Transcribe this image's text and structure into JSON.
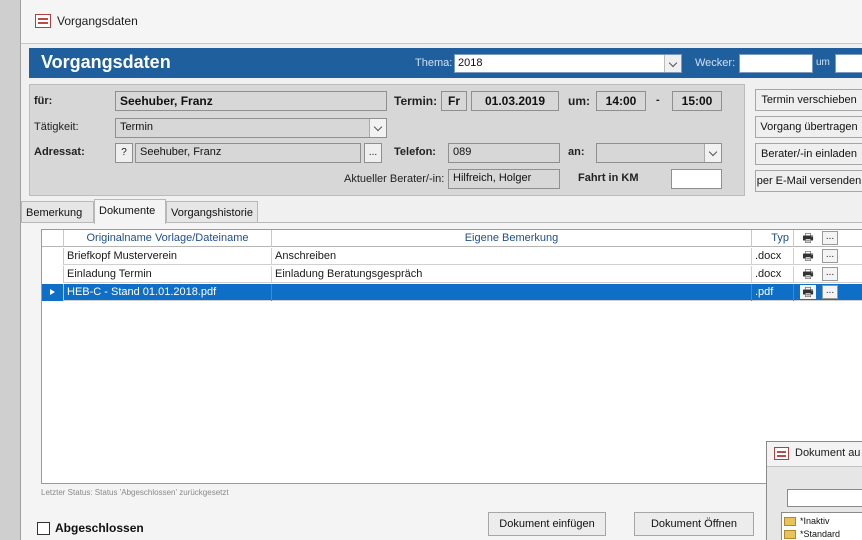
{
  "window": {
    "title": "Vorgangsdaten"
  },
  "header": {
    "title": "Vorgangsdaten",
    "thema_label": "Thema:",
    "thema_value": "2018",
    "wecker_label": "Wecker:",
    "um_label": "um"
  },
  "form": {
    "fuer_label": "für:",
    "fuer_value": "Seehuber, Franz",
    "termin_label": "Termin:",
    "termin_day": "Fr",
    "termin_date": "01.03.2019",
    "um_label": "um:",
    "time_from": "14:00",
    "dash": "-",
    "time_to": "15:00",
    "taetigkeit_label": "Tätigkeit:",
    "taetigkeit_value": "Termin",
    "adressat_label": "Adressat:",
    "adressat_q": "?",
    "adressat_value": "Seehuber, Franz",
    "dots": "...",
    "telefon_label": "Telefon:",
    "telefon_value": "089",
    "an_label": "an:",
    "berater_label": "Aktueller Berater/-in:",
    "berater_value": "Hilfreich, Holger",
    "fahrt_label": "Fahrt in KM"
  },
  "side_buttons": {
    "termin_verschieben": "Termin verschieben",
    "vorgang_uebertragen": "Vorgang übertragen",
    "berater_einladen": "Berater/-in einladen",
    "email_versenden": "per E-Mail versenden"
  },
  "tabs": [
    "Bemerkung",
    "Dokumente",
    "Vorgangshistorie"
  ],
  "grid": {
    "columns": [
      "Originalname Vorlage/Dateiname",
      "Eigene Bemerkung",
      "Typ"
    ],
    "rows": [
      {
        "name": "Briefkopf Musterverein",
        "note": "Anschreiben",
        "typ": ".docx"
      },
      {
        "name": "Einladung Termin",
        "note": "Einladung Beratungsgespräch",
        "typ": ".docx"
      },
      {
        "name": "HEB-C - Stand 01.01.2018.pdf",
        "note": "",
        "typ": ".pdf"
      }
    ],
    "dots": "..."
  },
  "status": {
    "text": "Letzter Status: Status 'Abgeschlossen' zurückgesetzt"
  },
  "footer": {
    "abgeschlossen_label": "Abgeschlossen",
    "dokument_einfuegen": "Dokument einfügen",
    "dokument_oeffnen": "Dokument Öffnen"
  },
  "dialog": {
    "title": "Dokument au",
    "items": [
      "*Inaktiv",
      "*Standard"
    ]
  }
}
